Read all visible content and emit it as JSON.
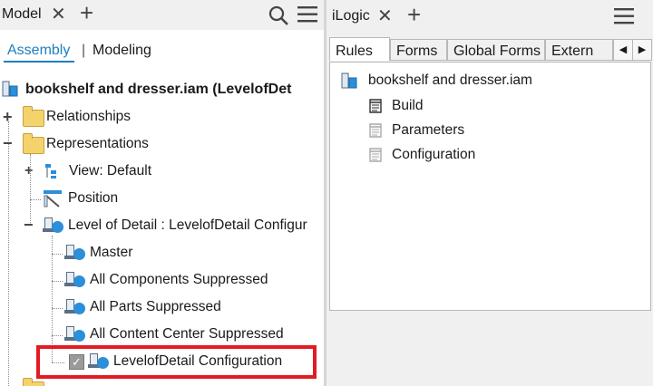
{
  "model_panel": {
    "title": "Model",
    "close_glyph": "✕",
    "add_glyph": "+",
    "subtabs": {
      "assembly": "Assembly",
      "separator": "|",
      "modeling": "Modeling"
    },
    "tree": {
      "root": "bookshelf and dresser.iam (LevelofDet",
      "relationships": "Relationships",
      "representations": "Representations",
      "view": "View: Default",
      "position": "Position",
      "level_of_detail": "Level of Detail : LevelofDetail  Configur",
      "lod_items": [
        "Master",
        "All Components Suppressed",
        "All Parts Suppressed",
        "All Content Center Suppressed",
        "LevelofDetail  Configuration"
      ],
      "expand_glyph": "+",
      "collapse_glyph": "−",
      "check_glyph": "✓"
    }
  },
  "ilogic_panel": {
    "title": "iLogic",
    "close_glyph": "✕",
    "add_glyph": "+",
    "tabs": [
      "Rules",
      "Forms",
      "Global Forms",
      "Extern"
    ],
    "active_tab": "Rules",
    "assembly": "bookshelf and dresser.iam",
    "rules": [
      "Build",
      "Parameters",
      "Configuration"
    ],
    "scroll_left": "◀",
    "scroll_right": "▶"
  },
  "colors": {
    "accent": "#1f7ec0",
    "highlight": "#e21b22",
    "folder": "#f5d36c",
    "lod_ball": "#2b8fd9"
  },
  "icons": [
    "search-icon",
    "hamburger-menu-icon",
    "folder-icon",
    "assembly-icon",
    "lod-icon",
    "rule-script-icon"
  ]
}
